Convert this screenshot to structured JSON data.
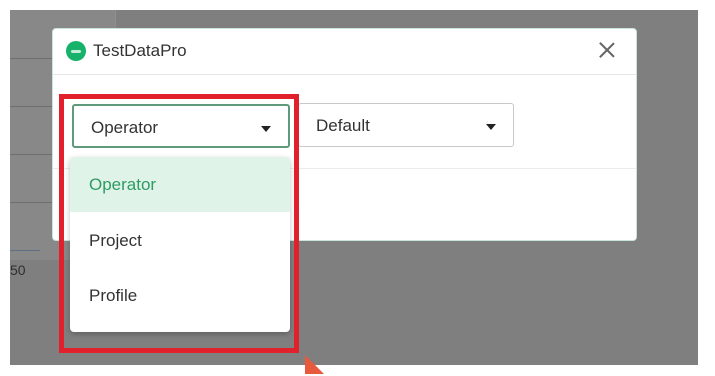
{
  "background": {
    "axis_tick_label": "50"
  },
  "dialog": {
    "title": "TestDataPro",
    "logo_icon": "app-logo-icon",
    "close_icon": "close-icon"
  },
  "selects": {
    "role": {
      "value": "Operator",
      "caret_icon": "caret-down-icon"
    },
    "profile": {
      "value": "Default",
      "caret_icon": "caret-down-icon"
    }
  },
  "dropdown": {
    "options": [
      {
        "label": "Operator",
        "selected": true
      },
      {
        "label": "Project",
        "selected": false
      },
      {
        "label": "Profile",
        "selected": false
      }
    ]
  },
  "colors": {
    "accent": "#2e9c63",
    "selected_bg": "#dff3e9",
    "highlight_border": "#e0202a",
    "overlay": "#7f7f7f"
  }
}
